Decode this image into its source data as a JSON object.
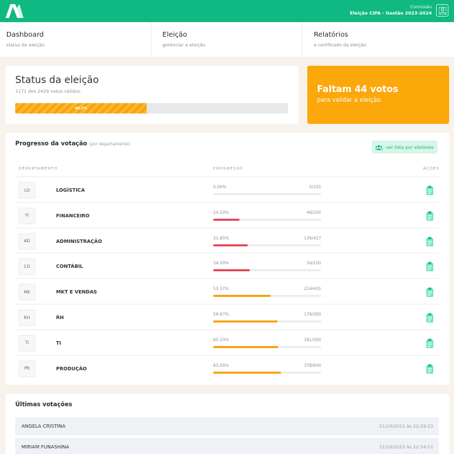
{
  "header": {
    "commission_label": "Comissão",
    "election_name": "Eleição CIPA - Gestão 2023-2024",
    "colors": {
      "brand": "#10b981"
    }
  },
  "nav": [
    {
      "title": "Dashboard",
      "subtitle": "status da eleição"
    },
    {
      "title": "Eleição",
      "subtitle": "gerenciar a eleição"
    },
    {
      "title": "Relatórios",
      "subtitle": "e certificado da eleição"
    }
  ],
  "status": {
    "title": "Status da eleição",
    "subtitle": "1171 dos 2429 votos válidos.",
    "percent_label": "48.2%",
    "progress": 0.482
  },
  "alert": {
    "title": "Faltam 44 votos",
    "subtitle": "para validar a eleição.",
    "color": "#fca70a"
  },
  "progress": {
    "title": "Progresso da votação",
    "title_note": "(por departamento)",
    "list_button": "ver lista por eleitores",
    "columns": {
      "dept": "DEPARTAMENTO",
      "progress": "PROGRESSO",
      "actions": "AÇÕES"
    },
    "rows": [
      {
        "abbr": "LO",
        "name": "LOGÍSTICA",
        "pct": "0.00%",
        "count": "0/101",
        "fraction": 0.0,
        "color": "#e5485b"
      },
      {
        "abbr": "FI",
        "name": "FINANCEIRO",
        "pct": "24.50%",
        "count": "49/200",
        "fraction": 0.245,
        "color": "#e5485b"
      },
      {
        "abbr": "AD",
        "name": "ADMINISTRAÇÃO",
        "pct": "31.85%",
        "count": "136/427",
        "fraction": 0.3185,
        "color": "#e5485b"
      },
      {
        "abbr": "CO",
        "name": "CONTÁBIL",
        "pct": "34.00%",
        "count": "34/100",
        "fraction": 0.34,
        "color": "#e5485b"
      },
      {
        "abbr": "MK",
        "name": "MKT E VENDAS",
        "pct": "53.37%",
        "count": "214/401",
        "fraction": 0.5337,
        "color": "#f7a20c"
      },
      {
        "abbr": "RH",
        "name": "RH",
        "pct": "59.67%",
        "count": "179/300",
        "fraction": 0.5967,
        "color": "#f7a20c"
      },
      {
        "abbr": "TI",
        "name": "TI",
        "pct": "60.33%",
        "count": "181/300",
        "fraction": 0.6033,
        "color": "#f7a20c"
      },
      {
        "abbr": "PR",
        "name": "PRODUÇÃO",
        "pct": "63.00%",
        "count": "378/600",
        "fraction": 0.63,
        "color": "#f7a20c"
      }
    ]
  },
  "recent": {
    "title": "Últimas votações",
    "items": [
      {
        "name": "ANGELA CRISTINA",
        "time": "31/10/2023 às 22:59:23"
      },
      {
        "name": "MIRIAM FUNASHINA",
        "time": "31/10/2023 às 22:54:51"
      }
    ]
  }
}
